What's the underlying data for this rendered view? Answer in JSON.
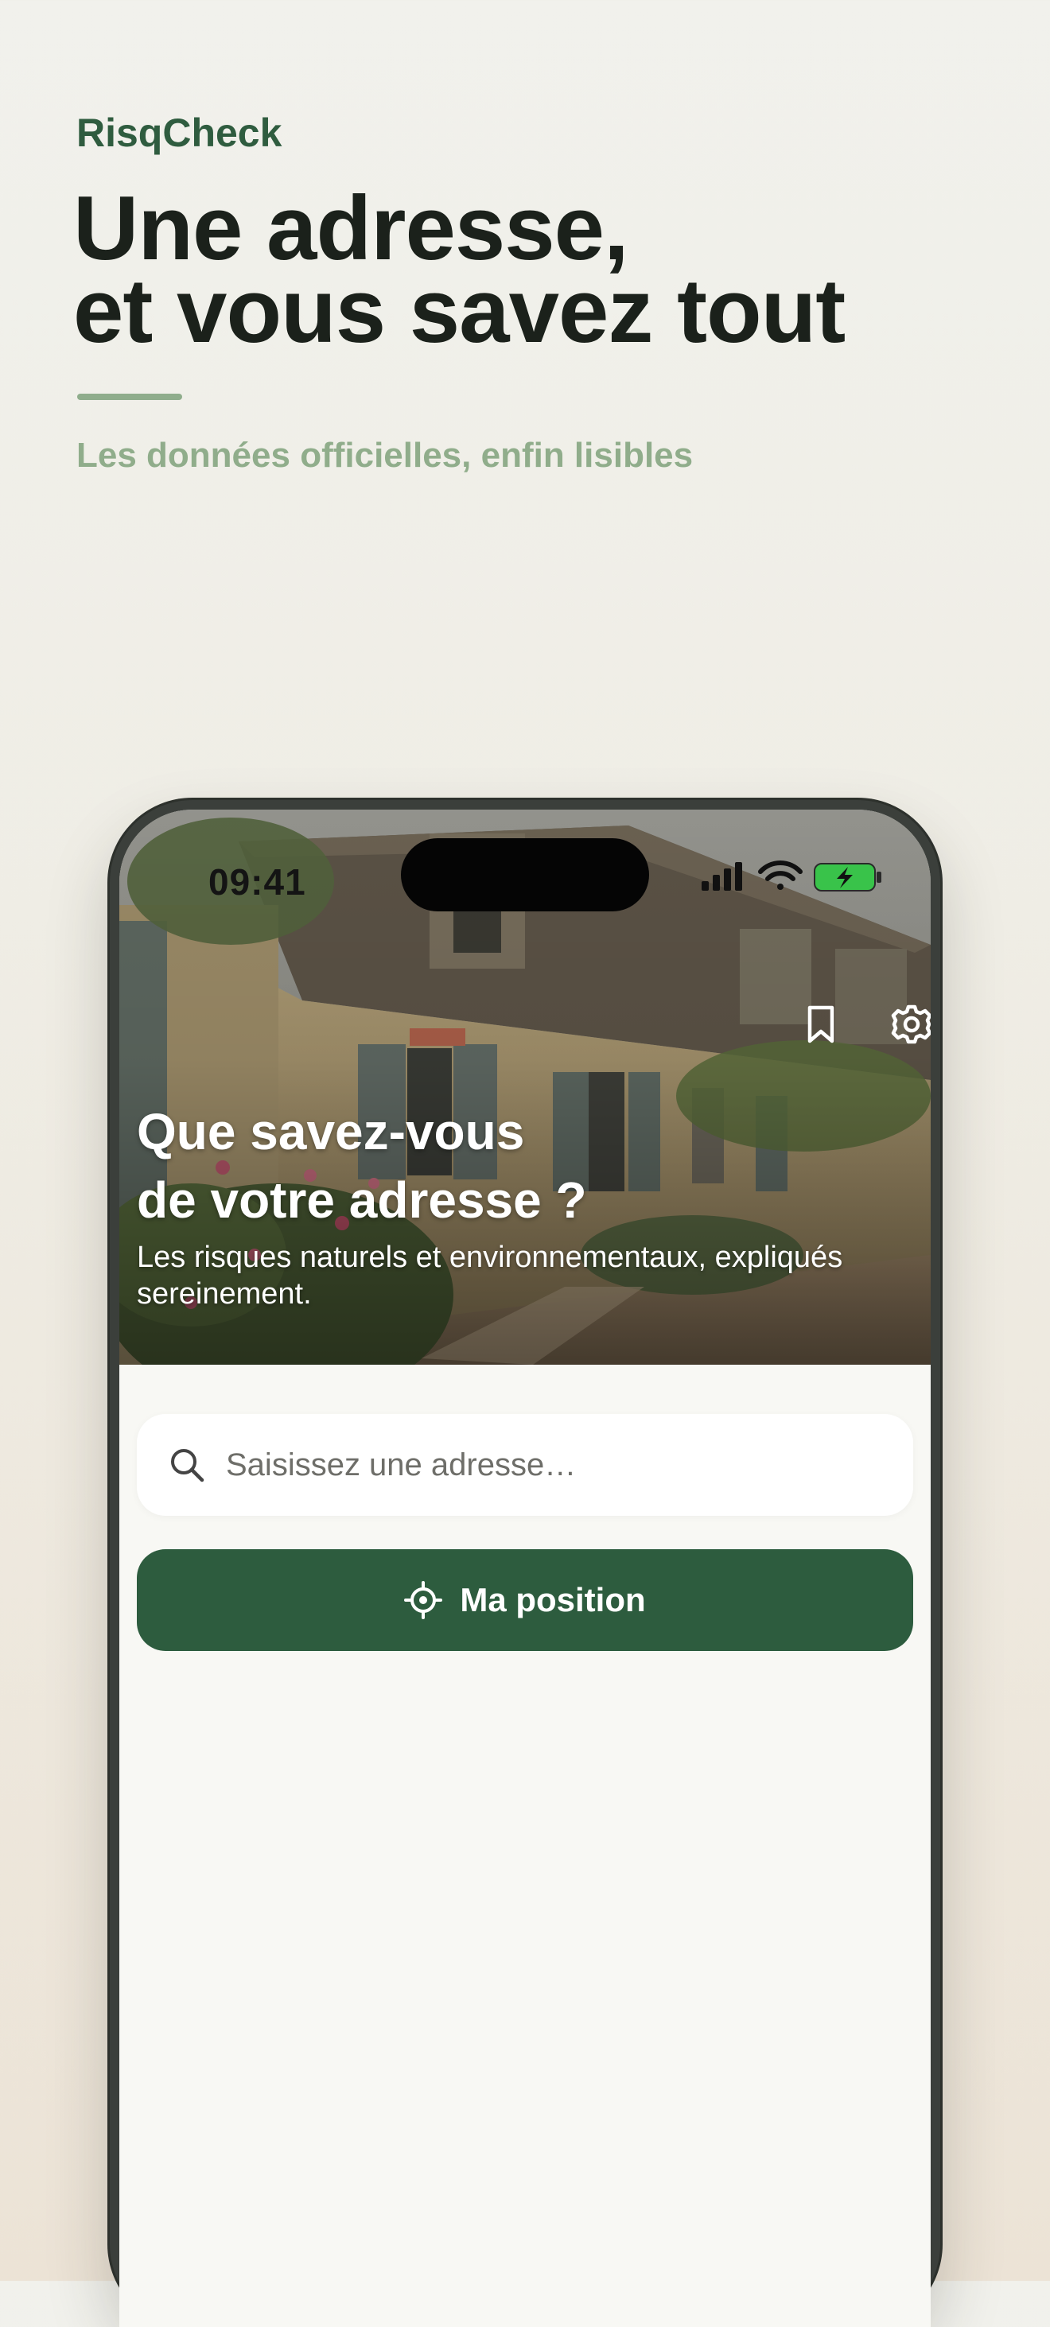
{
  "marketing": {
    "brand": "RisqCheck",
    "headline_line1": "Une adresse,",
    "headline_line2": "et vous savez tout",
    "subtitle": "Les données officielles, enfin lisibles"
  },
  "status_bar": {
    "time": "09:41",
    "icons": [
      "cellular-signal-icon",
      "wifi-icon",
      "battery-charging-icon"
    ]
  },
  "hero": {
    "title_line1": "Que savez-vous",
    "title_line2": "de votre adresse ?",
    "subtitle": "Les risques naturels et environnementaux, expliqués sereinement.",
    "icons": [
      "bookmark-icon",
      "gear-icon"
    ]
  },
  "search": {
    "placeholder": "Saisissez une adresse…",
    "value": "",
    "icon": "search-icon"
  },
  "locate_button": {
    "label": "Ma position",
    "icon": "crosshair-icon"
  },
  "colors": {
    "brand_green": "#2f5c3f",
    "button_green": "#2d5c3e",
    "accent_sage": "#90ad8b",
    "headline_dark": "#1b211b",
    "battery_green": "#39c34a"
  }
}
